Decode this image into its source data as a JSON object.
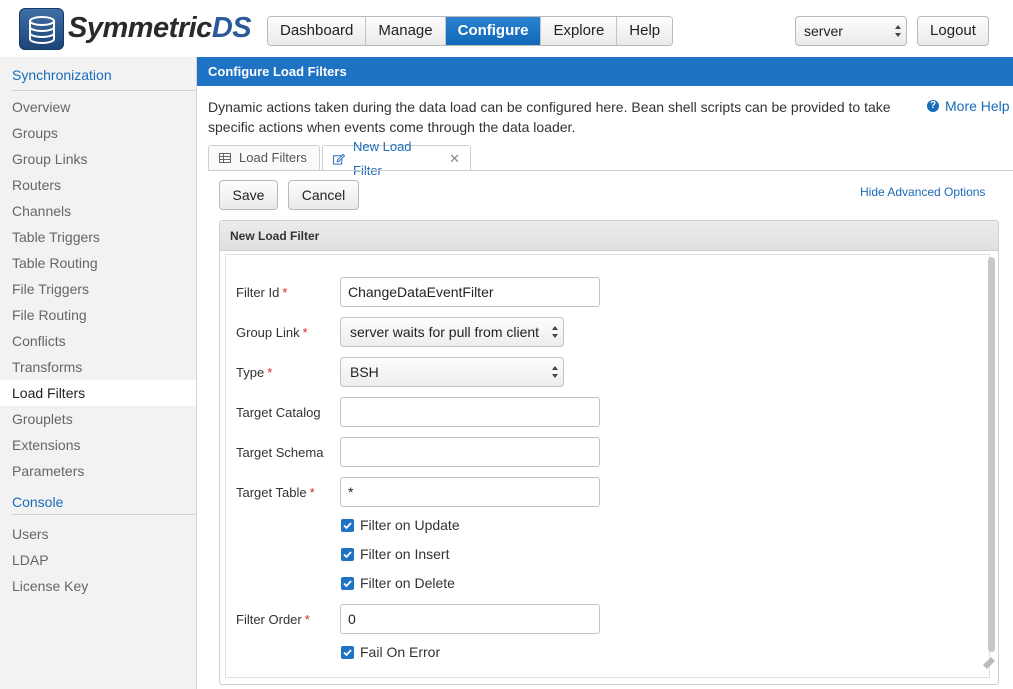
{
  "brand": {
    "name_a": "Symmetric",
    "name_b": "DS"
  },
  "nav": [
    {
      "label": "Dashboard",
      "active": false
    },
    {
      "label": "Manage",
      "active": false
    },
    {
      "label": "Configure",
      "active": true
    },
    {
      "label": "Explore",
      "active": false
    },
    {
      "label": "Help",
      "active": false
    }
  ],
  "server_select": {
    "value": "server"
  },
  "logout_label": "Logout",
  "sidebar": {
    "section1": "Synchronization",
    "items1": [
      "Overview",
      "Groups",
      "Group Links",
      "Routers",
      "Channels",
      "Table Triggers",
      "Table Routing",
      "File Triggers",
      "File Routing",
      "Conflicts",
      "Transforms",
      "Load Filters",
      "Grouplets",
      "Extensions",
      "Parameters"
    ],
    "section2": "Console",
    "items2": [
      "Users",
      "LDAP",
      "License Key"
    ],
    "active_item": "Load Filters"
  },
  "page_title": "Configure Load Filters",
  "description": "Dynamic actions taken during the data load can be configured here. Bean shell scripts can be provided to take specific actions when events come through the data loader.",
  "more_help": "More Help",
  "tabs": [
    {
      "label": "Load Filters",
      "icon": "table-icon"
    },
    {
      "label": "New Load Filter",
      "icon": "edit-icon",
      "closable": true
    }
  ],
  "buttons": {
    "save": "Save",
    "cancel": "Cancel",
    "hide_advanced": "Hide Advanced Options"
  },
  "panel_title": "New Load Filter",
  "form": {
    "filter_id": {
      "label": "Filter Id",
      "value": "ChangeDataEventFilter"
    },
    "group_link": {
      "label": "Group Link",
      "value": "server waits for pull from client"
    },
    "type": {
      "label": "Type",
      "value": "BSH"
    },
    "target_catalog": {
      "label": "Target Catalog",
      "value": ""
    },
    "target_schema": {
      "label": "Target Schema",
      "value": ""
    },
    "target_table": {
      "label": "Target Table",
      "value": "*"
    },
    "filter_on_update": {
      "label": "Filter on Update",
      "checked": true
    },
    "filter_on_insert": {
      "label": "Filter on Insert",
      "checked": true
    },
    "filter_on_delete": {
      "label": "Filter on Delete",
      "checked": true
    },
    "filter_order": {
      "label": "Filter Order",
      "value": "0"
    },
    "fail_on_error": {
      "label": "Fail On Error",
      "checked": true
    }
  },
  "colors": {
    "accent": "#1f73c4",
    "required": "#d9232e",
    "link": "#1a6bb8"
  }
}
